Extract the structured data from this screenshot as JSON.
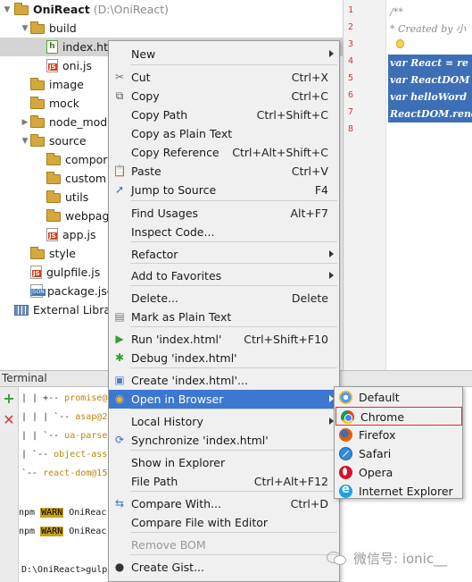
{
  "project_tree": {
    "root": {
      "name": "OniReact",
      "path": "(D:\\OniReact)"
    },
    "items": [
      {
        "label": "build",
        "icon": "folder-icon",
        "arrow": "expanded"
      },
      {
        "label": "index.html",
        "icon": "html-file-icon",
        "arrow": "",
        "selected": true
      },
      {
        "label": "oni.js",
        "icon": "js-file-icon",
        "arrow": ""
      },
      {
        "label": "image",
        "icon": "folder-icon",
        "arrow": ""
      },
      {
        "label": "mock",
        "icon": "folder-icon",
        "arrow": ""
      },
      {
        "label": "node_modu",
        "icon": "folder-icon",
        "arrow": "collapsed"
      },
      {
        "label": "source",
        "icon": "folder-icon",
        "arrow": "expanded"
      },
      {
        "label": "compor",
        "icon": "folder-icon",
        "arrow": ""
      },
      {
        "label": "custom",
        "icon": "folder-icon",
        "arrow": ""
      },
      {
        "label": "utils",
        "icon": "folder-icon",
        "arrow": ""
      },
      {
        "label": "webpag",
        "icon": "folder-icon",
        "arrow": ""
      },
      {
        "label": "app.js",
        "icon": "js-file-icon",
        "arrow": ""
      },
      {
        "label": "style",
        "icon": "folder-icon",
        "arrow": ""
      },
      {
        "label": "gulpfile.js",
        "icon": "js-file-icon",
        "arrow": ""
      },
      {
        "label": "package.jsc",
        "icon": "json-file-icon",
        "arrow": ""
      },
      {
        "label": "External Librari",
        "icon": "library-icon",
        "arrow": ""
      }
    ]
  },
  "editor": {
    "line_numbers": [
      "1",
      "2",
      "3",
      "4",
      "5",
      "6",
      "7",
      "8"
    ],
    "lines": [
      {
        "text": "/**",
        "style": "comment"
      },
      {
        "text": " * Created by 小",
        "style": "comment"
      },
      {
        "text": "",
        "style": "plain"
      },
      {
        "text": "var React = re",
        "style": "hl"
      },
      {
        "text": "var ReactDOM =",
        "style": "hl"
      },
      {
        "text": "var helloWord",
        "style": "hl"
      },
      {
        "text": "ReactDOM.rende",
        "style": "hl"
      },
      {
        "text": "",
        "style": "plain"
      }
    ]
  },
  "terminal": {
    "title": "Terminal",
    "lines": [
      {
        "prefix": "| | +-- ",
        "dep": "promise@"
      },
      {
        "prefix": "| | | `-- ",
        "dep": "asap@2"
      },
      {
        "prefix": "| | `-- ",
        "dep": "ua-parse"
      },
      {
        "prefix": "| `-- ",
        "dep": "object-ass"
      },
      {
        "prefix": "`-- ",
        "dep": "react-dom@15"
      }
    ],
    "warn_lines": [
      {
        "prefix": "npm ",
        "tag": "WARN",
        "text": " OniReac"
      },
      {
        "prefix": "npm ",
        "tag": "WARN",
        "text": " OniReac"
      }
    ],
    "prompt": "D:\\OniReact>gulp"
  },
  "context_menu": {
    "items": [
      {
        "label": "New",
        "shortcut": "",
        "submenu": true,
        "icon": ""
      },
      {
        "label": "Cut",
        "shortcut": "Ctrl+X",
        "icon": "scissors-icon"
      },
      {
        "label": "Copy",
        "shortcut": "Ctrl+C",
        "icon": "copy-icon"
      },
      {
        "label": "Copy Path",
        "shortcut": "Ctrl+Shift+C",
        "icon": ""
      },
      {
        "label": "Copy as Plain Text",
        "shortcut": "",
        "icon": ""
      },
      {
        "label": "Copy Reference",
        "shortcut": "Ctrl+Alt+Shift+C",
        "icon": ""
      },
      {
        "label": "Paste",
        "shortcut": "Ctrl+V",
        "icon": "paste-icon"
      },
      {
        "label": "Jump to Source",
        "shortcut": "F4",
        "icon": "jump-arrow-icon"
      },
      {
        "label": "Find Usages",
        "shortcut": "Alt+F7",
        "icon": ""
      },
      {
        "label": "Inspect Code...",
        "shortcut": "",
        "icon": ""
      },
      {
        "label": "Refactor",
        "shortcut": "",
        "submenu": true,
        "icon": ""
      },
      {
        "label": "Add to Favorites",
        "shortcut": "",
        "submenu": true,
        "icon": ""
      },
      {
        "label": "Delete...",
        "shortcut": "Delete",
        "icon": ""
      },
      {
        "label": "Mark as Plain Text",
        "shortcut": "",
        "icon": "plain-text-icon"
      },
      {
        "label": "Run 'index.html'",
        "shortcut": "Ctrl+Shift+F10",
        "icon": "run-icon"
      },
      {
        "label": "Debug 'index.html'",
        "shortcut": "",
        "icon": "debug-icon"
      },
      {
        "label": "Create 'index.html'...",
        "shortcut": "",
        "icon": "create-config-icon"
      },
      {
        "label": "Open in Browser",
        "shortcut": "",
        "submenu": true,
        "active": true,
        "icon": "browser-icon"
      },
      {
        "label": "Local History",
        "shortcut": "",
        "submenu": true,
        "icon": ""
      },
      {
        "label": "Synchronize 'index.html'",
        "shortcut": "",
        "icon": "sync-icon"
      },
      {
        "label": "Show in Explorer",
        "shortcut": "",
        "icon": ""
      },
      {
        "label": "File Path",
        "shortcut": "Ctrl+Alt+F12",
        "icon": ""
      },
      {
        "label": "Compare With...",
        "shortcut": "Ctrl+D",
        "icon": "compare-icon"
      },
      {
        "label": "Compare File with Editor",
        "shortcut": "",
        "icon": ""
      },
      {
        "label": "Remove BOM",
        "shortcut": "",
        "disabled": true,
        "icon": ""
      },
      {
        "label": "Create Gist...",
        "shortcut": "",
        "icon": "github-icon"
      }
    ]
  },
  "browser_submenu": {
    "items": [
      {
        "label": "Default",
        "icon": "default-browser-icon"
      },
      {
        "label": "Chrome",
        "icon": "chrome-icon",
        "highlighted": true
      },
      {
        "label": "Firefox",
        "icon": "firefox-icon"
      },
      {
        "label": "Safari",
        "icon": "safari-icon"
      },
      {
        "label": "Opera",
        "icon": "opera-icon"
      },
      {
        "label": "Internet Explorer",
        "icon": "internet-explorer-icon"
      }
    ]
  },
  "watermark": {
    "text": "微信号: ionic__"
  },
  "colors": {
    "menu_active": "#3c78d2",
    "highlight_border": "#d9302c",
    "line_numbers": "#cf3a2e",
    "code_selection": "#3d6fb6"
  }
}
